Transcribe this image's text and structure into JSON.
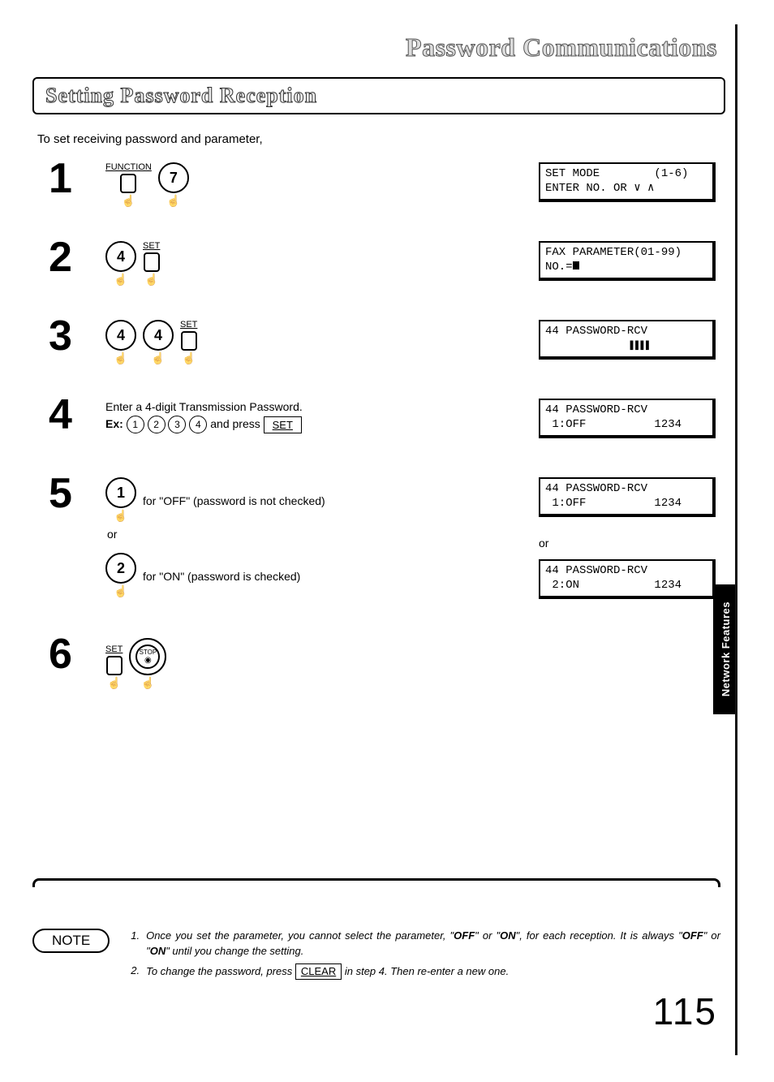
{
  "title": "Password Communications",
  "section_heading": "Setting Password Reception",
  "intro": "To set receiving password and parameter,",
  "steps": {
    "s1": {
      "num": "1",
      "func_label": "FUNCTION",
      "key": "7"
    },
    "s2": {
      "num": "2",
      "key": "4",
      "set_label": "SET"
    },
    "s3": {
      "num": "3",
      "key_a": "4",
      "key_b": "4",
      "set_label": "SET"
    },
    "s4": {
      "num": "4",
      "line1": "Enter a 4-digit Transmission Password.",
      "ex_label": "Ex:",
      "ex_keys": [
        "1",
        "2",
        "3",
        "4"
      ],
      "and_press": " and press ",
      "set_box": "SET"
    },
    "s5": {
      "num": "5",
      "key_off": "1",
      "text_off": "for \"OFF\" (password is not checked)",
      "or": "or",
      "key_on": "2",
      "text_on": "for \"ON\" (password is checked)"
    },
    "s6": {
      "num": "6",
      "set_label": "SET",
      "stop_label": "STOP"
    }
  },
  "lcd": {
    "d1_l1": "SET MODE        (1-6)",
    "d1_l2": "ENTER NO. OR ∨ ∧",
    "d2_l1": "FAX PARAMETER(01-99)",
    "d2_l2": "NO.=",
    "d3_l1": "44 PASSWORD-RCV",
    "d3_l2": "                ❚❚❚❚",
    "d4_l1": "44 PASSWORD-RCV",
    "d4_l2": " 1:OFF          1234",
    "d5_l1": "44 PASSWORD-RCV",
    "d5_l2": " 1:OFF          1234",
    "d5_or": "or",
    "d5b_l1": "44 PASSWORD-RCV",
    "d5b_l2": " 2:ON           1234"
  },
  "tab": "Network Features",
  "note_label": "NOTE",
  "notes": {
    "n1_num": "1.",
    "n1_a": "Once you set the parameter, you cannot select the parameter, \"",
    "n1_off": "OFF",
    "n1_b": "\" or \"",
    "n1_on": "ON",
    "n1_c": "\", for each reception. It is always \"",
    "n1_off2": "OFF",
    "n1_d": "\" or \"",
    "n1_on2": "ON",
    "n1_e": "\" until you change the setting.",
    "n2_num": "2.",
    "n2_a": "To change the password, press ",
    "n2_clear": "CLEAR",
    "n2_b": " in step 4. Then re-enter a new one."
  },
  "page_number": "115"
}
